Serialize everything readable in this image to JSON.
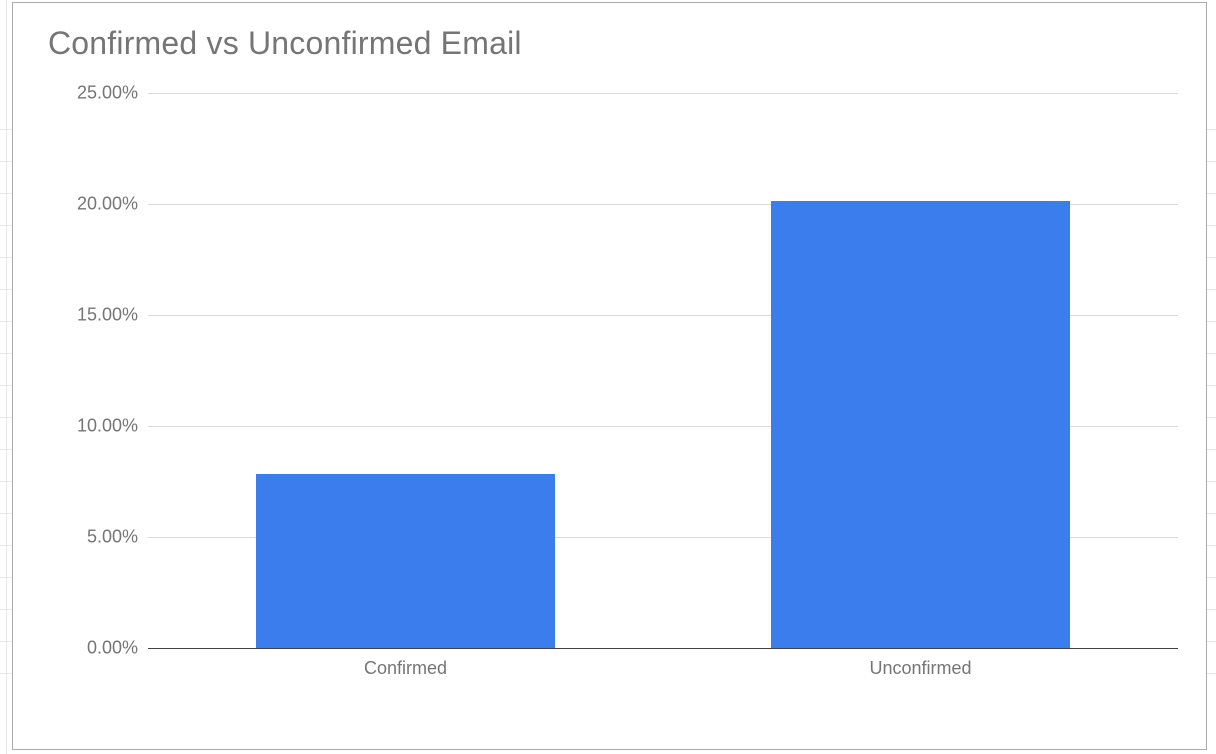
{
  "chart_data": {
    "type": "bar",
    "title": "Confirmed vs Unconfirmed Email",
    "categories": [
      "Confirmed",
      "Unconfirmed"
    ],
    "values": [
      7.82,
      20.12
    ],
    "value_format": "percent",
    "ylim": [
      0,
      25
    ],
    "ytick_step": 5,
    "y_ticks": [
      "0.00%",
      "5.00%",
      "10.00%",
      "15.00%",
      "20.00%",
      "25.00%"
    ],
    "bar_color": "#3b7ded",
    "grid": true
  }
}
